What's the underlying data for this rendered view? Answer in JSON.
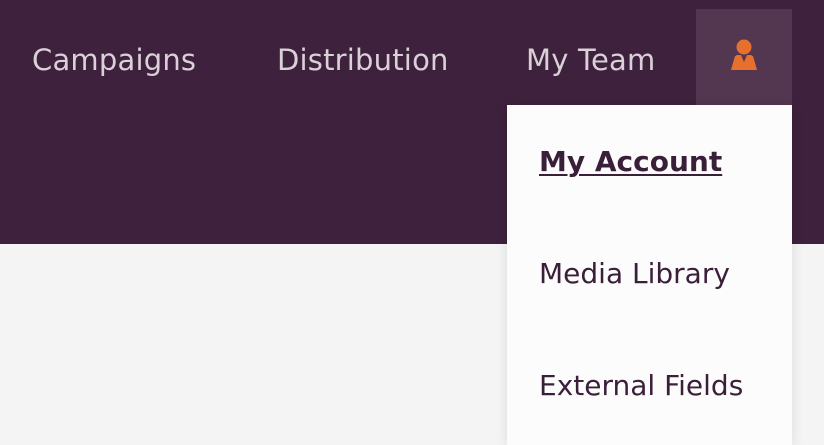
{
  "nav": {
    "items": [
      {
        "label": "Campaigns"
      },
      {
        "label": "Distribution"
      },
      {
        "label": "My Team"
      }
    ],
    "user_button": {
      "icon": "user-icon",
      "accent": "#e8702f"
    }
  },
  "dropdown": {
    "items": [
      {
        "label": "My Account",
        "active": true
      },
      {
        "label": "Media Library"
      },
      {
        "label": "External Fields"
      }
    ]
  },
  "colors": {
    "header_bg": "#3e213c",
    "nav_text": "#d9d0d8",
    "menu_text": "#3a1f39",
    "page_bg": "#f4f4f5"
  }
}
